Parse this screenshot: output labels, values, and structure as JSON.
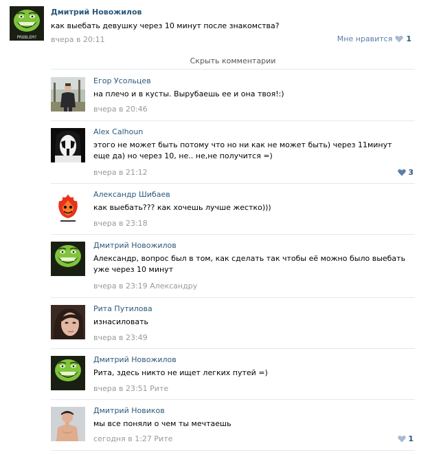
{
  "post": {
    "author": "Дмитрий Новожилов",
    "text": "как выебать девушку через 10 минут после знакомства?",
    "time": "вчера в 20:11",
    "like_label": "Мне нравится",
    "like_count": "1",
    "avatar": "troll-face-problem",
    "avatar_caption": "PROBLEM?"
  },
  "hide_comments_label": "Скрыть комментарии",
  "comments": [
    {
      "author": "Егор Усольцев",
      "text": "на плечо и в кусты. Вырубаешь ее и она твоя!:)",
      "time": "вчера в 20:46",
      "reply_to": "",
      "likes": "",
      "avatar": "photo-man-forest"
    },
    {
      "author": "Alex Calhoun",
      "text": "этого не может быть потому что но ни как не может быть) через 11минут еще да) но через 10, не.. не,не получится =)",
      "time": "вчера в 21:12",
      "reply_to": "",
      "likes": "3",
      "avatar": "corpse-paint-face"
    },
    {
      "author": "Александр Шибаев",
      "text": "как выебать??? как хочешь лучше жестко)))",
      "time": "вчера в 23:18",
      "reply_to": "",
      "likes": "",
      "avatar": "flame-logo"
    },
    {
      "author": "Дмитрий Новожилов",
      "text": "Александр, вопрос был в том, как сделать так чтобы её можно было выебать уже через 10 минут",
      "time": "вчера в 23:19",
      "reply_to": "Александру",
      "likes": "",
      "avatar": "troll-face-problem"
    },
    {
      "author": "Рита Путилова",
      "text": "изнасиловать",
      "time": "вчера в 23:49",
      "reply_to": "",
      "likes": "",
      "avatar": "photo-girl"
    },
    {
      "author": "Дмитрий Новожилов",
      "text": "Рита, здесь никто не ищет легких путей =)",
      "time": "вчера в 23:51",
      "reply_to": "Рите",
      "likes": "",
      "avatar": "troll-face-problem"
    },
    {
      "author": "Дмитрий Новиков",
      "text": "мы все поняли о чем ты мечтаешь",
      "time": "сегодня в 1:27",
      "reply_to": "Рите",
      "likes": "1",
      "avatar": "photo-shirtless-man"
    }
  ],
  "colors": {
    "link": "#2B587A",
    "meta": "#999999",
    "divider": "#E4E8ED",
    "heart": "#A7BBD1",
    "heart_active": "#5B7EA8"
  }
}
